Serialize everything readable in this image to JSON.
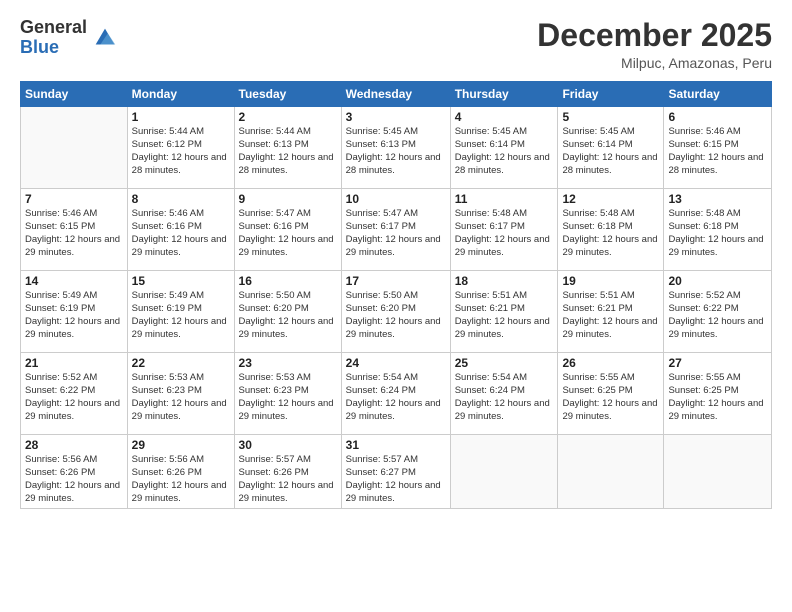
{
  "logo": {
    "general": "General",
    "blue": "Blue"
  },
  "title": "December 2025",
  "location": "Milpuc, Amazonas, Peru",
  "days_of_week": [
    "Sunday",
    "Monday",
    "Tuesday",
    "Wednesday",
    "Thursday",
    "Friday",
    "Saturday"
  ],
  "weeks": [
    [
      {
        "day": "",
        "info": ""
      },
      {
        "day": "1",
        "info": "Sunrise: 5:44 AM\nSunset: 6:12 PM\nDaylight: 12 hours and 28 minutes."
      },
      {
        "day": "2",
        "info": "Sunrise: 5:44 AM\nSunset: 6:13 PM\nDaylight: 12 hours and 28 minutes."
      },
      {
        "day": "3",
        "info": "Sunrise: 5:45 AM\nSunset: 6:13 PM\nDaylight: 12 hours and 28 minutes."
      },
      {
        "day": "4",
        "info": "Sunrise: 5:45 AM\nSunset: 6:14 PM\nDaylight: 12 hours and 28 minutes."
      },
      {
        "day": "5",
        "info": "Sunrise: 5:45 AM\nSunset: 6:14 PM\nDaylight: 12 hours and 28 minutes."
      },
      {
        "day": "6",
        "info": "Sunrise: 5:46 AM\nSunset: 6:15 PM\nDaylight: 12 hours and 28 minutes."
      }
    ],
    [
      {
        "day": "7",
        "info": "Sunrise: 5:46 AM\nSunset: 6:15 PM\nDaylight: 12 hours and 29 minutes."
      },
      {
        "day": "8",
        "info": "Sunrise: 5:46 AM\nSunset: 6:16 PM\nDaylight: 12 hours and 29 minutes."
      },
      {
        "day": "9",
        "info": "Sunrise: 5:47 AM\nSunset: 6:16 PM\nDaylight: 12 hours and 29 minutes."
      },
      {
        "day": "10",
        "info": "Sunrise: 5:47 AM\nSunset: 6:17 PM\nDaylight: 12 hours and 29 minutes."
      },
      {
        "day": "11",
        "info": "Sunrise: 5:48 AM\nSunset: 6:17 PM\nDaylight: 12 hours and 29 minutes."
      },
      {
        "day": "12",
        "info": "Sunrise: 5:48 AM\nSunset: 6:18 PM\nDaylight: 12 hours and 29 minutes."
      },
      {
        "day": "13",
        "info": "Sunrise: 5:48 AM\nSunset: 6:18 PM\nDaylight: 12 hours and 29 minutes."
      }
    ],
    [
      {
        "day": "14",
        "info": "Sunrise: 5:49 AM\nSunset: 6:19 PM\nDaylight: 12 hours and 29 minutes."
      },
      {
        "day": "15",
        "info": "Sunrise: 5:49 AM\nSunset: 6:19 PM\nDaylight: 12 hours and 29 minutes."
      },
      {
        "day": "16",
        "info": "Sunrise: 5:50 AM\nSunset: 6:20 PM\nDaylight: 12 hours and 29 minutes."
      },
      {
        "day": "17",
        "info": "Sunrise: 5:50 AM\nSunset: 6:20 PM\nDaylight: 12 hours and 29 minutes."
      },
      {
        "day": "18",
        "info": "Sunrise: 5:51 AM\nSunset: 6:21 PM\nDaylight: 12 hours and 29 minutes."
      },
      {
        "day": "19",
        "info": "Sunrise: 5:51 AM\nSunset: 6:21 PM\nDaylight: 12 hours and 29 minutes."
      },
      {
        "day": "20",
        "info": "Sunrise: 5:52 AM\nSunset: 6:22 PM\nDaylight: 12 hours and 29 minutes."
      }
    ],
    [
      {
        "day": "21",
        "info": "Sunrise: 5:52 AM\nSunset: 6:22 PM\nDaylight: 12 hours and 29 minutes."
      },
      {
        "day": "22",
        "info": "Sunrise: 5:53 AM\nSunset: 6:23 PM\nDaylight: 12 hours and 29 minutes."
      },
      {
        "day": "23",
        "info": "Sunrise: 5:53 AM\nSunset: 6:23 PM\nDaylight: 12 hours and 29 minutes."
      },
      {
        "day": "24",
        "info": "Sunrise: 5:54 AM\nSunset: 6:24 PM\nDaylight: 12 hours and 29 minutes."
      },
      {
        "day": "25",
        "info": "Sunrise: 5:54 AM\nSunset: 6:24 PM\nDaylight: 12 hours and 29 minutes."
      },
      {
        "day": "26",
        "info": "Sunrise: 5:55 AM\nSunset: 6:25 PM\nDaylight: 12 hours and 29 minutes."
      },
      {
        "day": "27",
        "info": "Sunrise: 5:55 AM\nSunset: 6:25 PM\nDaylight: 12 hours and 29 minutes."
      }
    ],
    [
      {
        "day": "28",
        "info": "Sunrise: 5:56 AM\nSunset: 6:26 PM\nDaylight: 12 hours and 29 minutes."
      },
      {
        "day": "29",
        "info": "Sunrise: 5:56 AM\nSunset: 6:26 PM\nDaylight: 12 hours and 29 minutes."
      },
      {
        "day": "30",
        "info": "Sunrise: 5:57 AM\nSunset: 6:26 PM\nDaylight: 12 hours and 29 minutes."
      },
      {
        "day": "31",
        "info": "Sunrise: 5:57 AM\nSunset: 6:27 PM\nDaylight: 12 hours and 29 minutes."
      },
      {
        "day": "",
        "info": ""
      },
      {
        "day": "",
        "info": ""
      },
      {
        "day": "",
        "info": ""
      }
    ]
  ]
}
